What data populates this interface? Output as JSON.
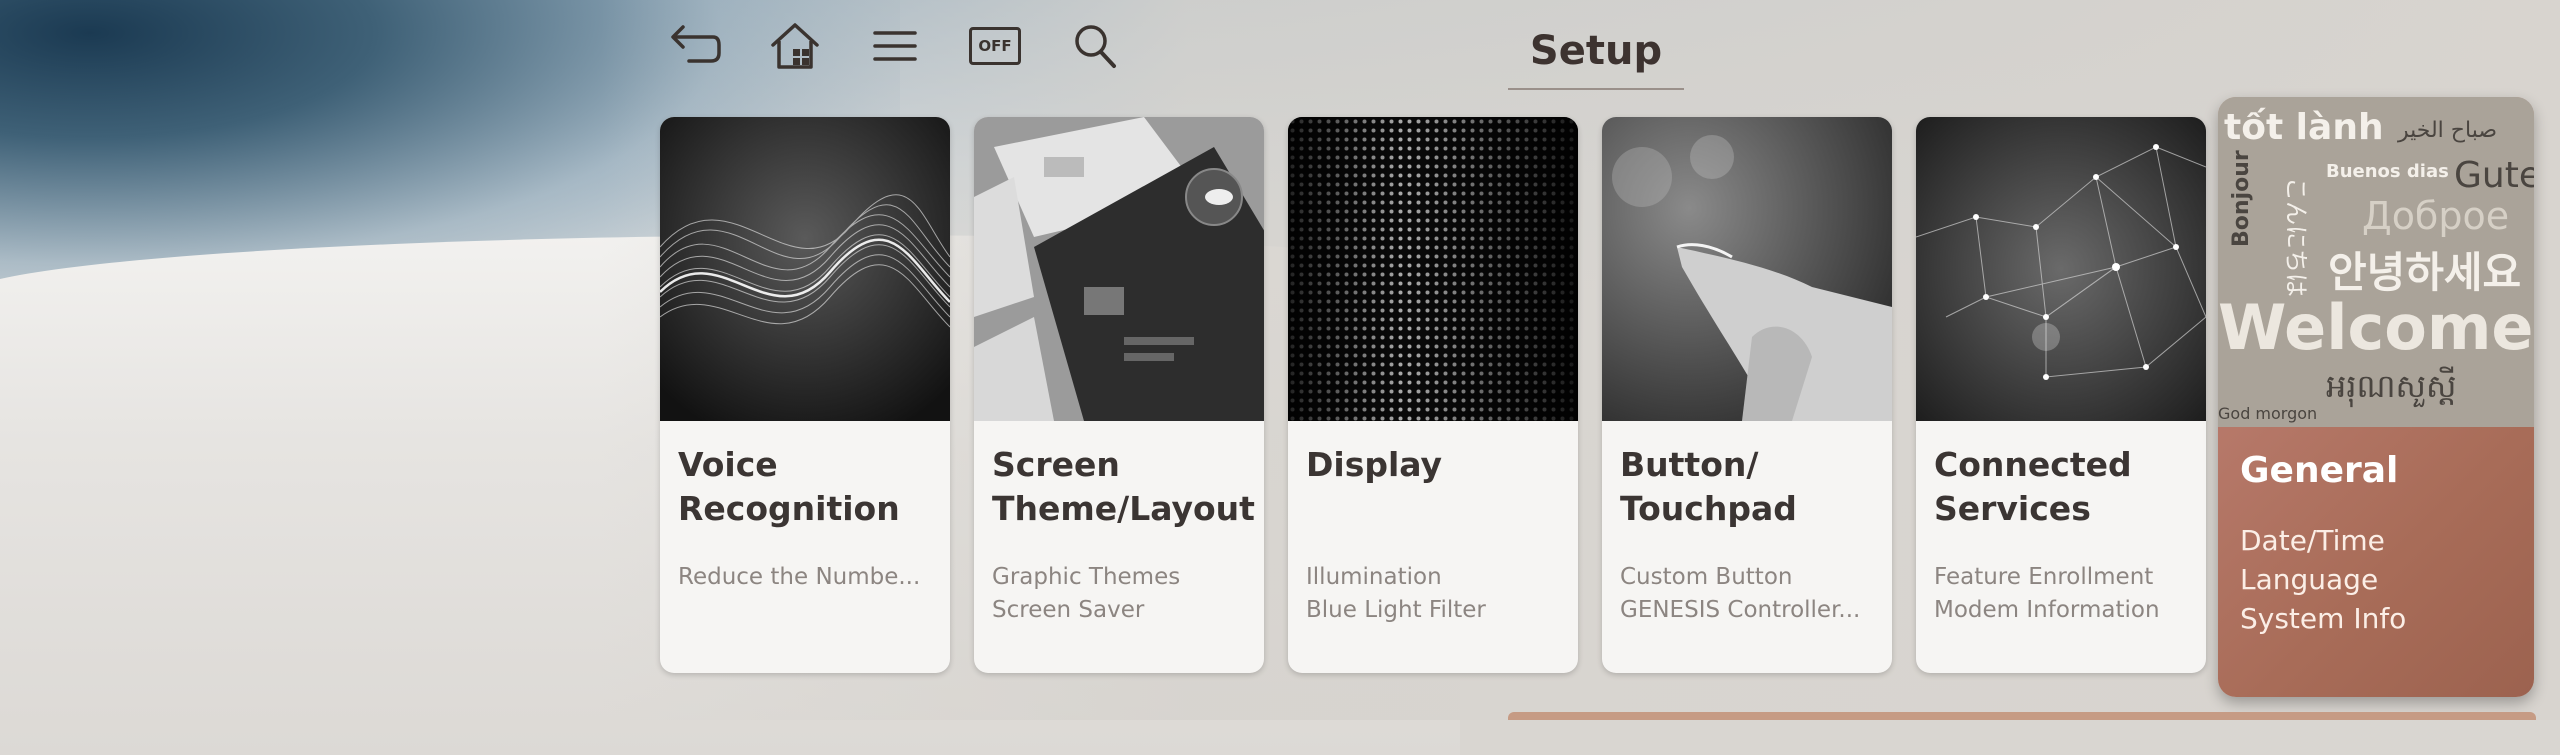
{
  "toolbar": {
    "items": [
      {
        "icon": "back-icon"
      },
      {
        "icon": "home-icon"
      },
      {
        "icon": "menu-icon"
      },
      {
        "icon": "screen-off-icon",
        "label": "OFF"
      },
      {
        "icon": "search-icon"
      }
    ]
  },
  "page": {
    "title": "Setup"
  },
  "cards": [
    {
      "title": "Voice Recognition",
      "lines": [
        "Reduce the Numbe..."
      ]
    },
    {
      "title": "Screen Theme/Layout",
      "lines": [
        "Graphic Themes",
        "Screen Saver"
      ]
    },
    {
      "title": "Display",
      "lines": [
        "Illumination",
        "Blue Light Filter"
      ]
    },
    {
      "title": "Button/ Touchpad",
      "lines": [
        "Custom Button",
        "GENESIS Controller..."
      ]
    },
    {
      "title": "Connected Services",
      "lines": [
        "Feature Enrollment",
        "Modem Information"
      ]
    },
    {
      "title": "General",
      "lines": [
        "Date/Time",
        "Language",
        "System Info"
      ]
    }
  ],
  "general_image_words": [
    "tốt lành",
    "صباح الخير",
    "Buenos dias",
    "Guten",
    "Bonjour",
    "こんにちは",
    "Доброе",
    "안녕하세요",
    "Welcome",
    "អរុណសួស្តី",
    "God morgon"
  ],
  "colors": {
    "accent": "#b7796a",
    "text": "#3b3533",
    "subtext": "#8c8581"
  }
}
